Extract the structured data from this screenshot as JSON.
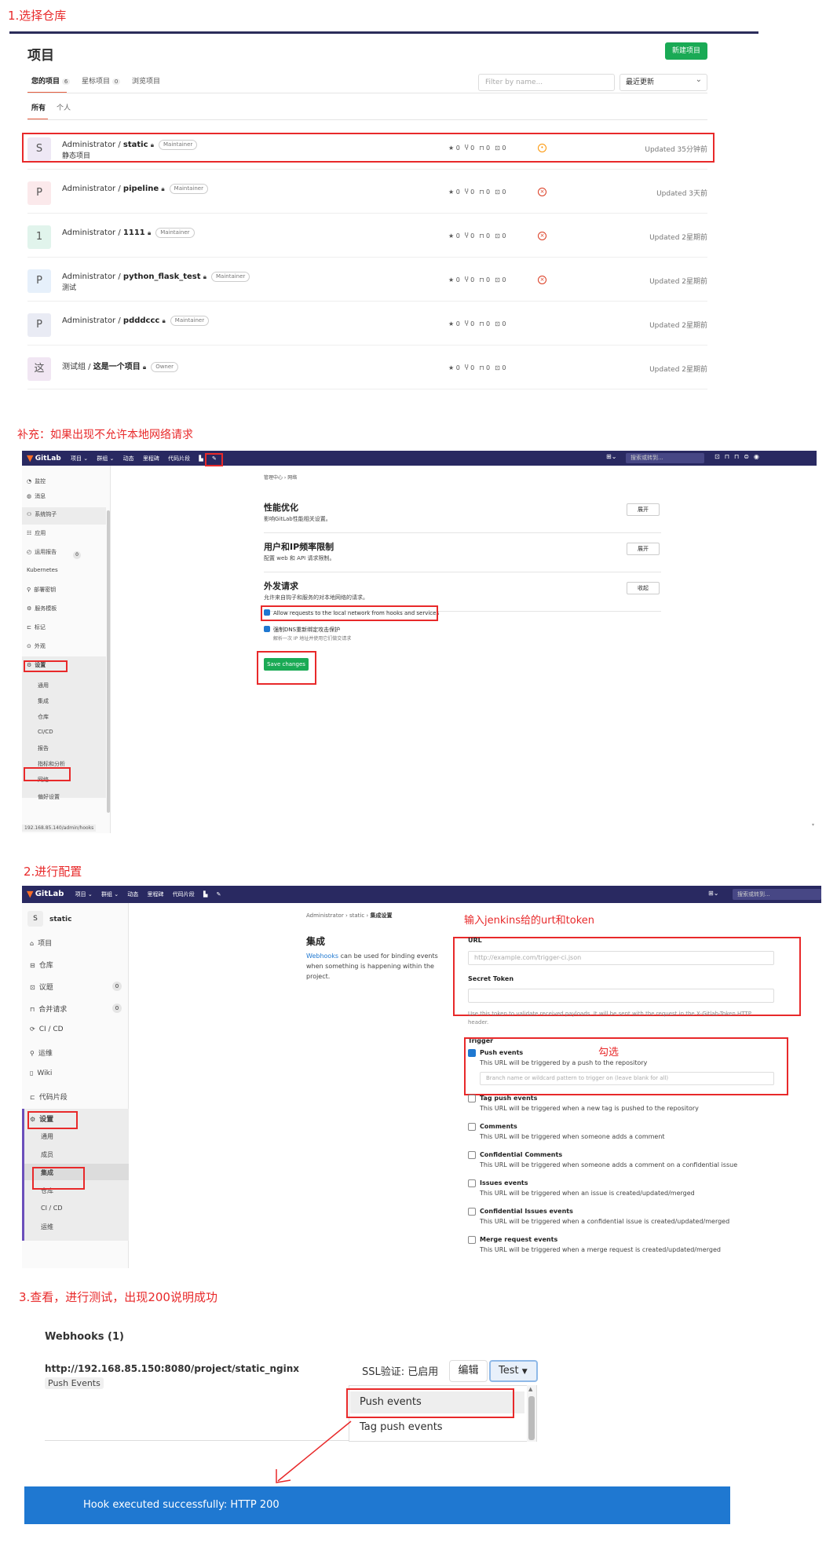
{
  "steps": {
    "s1": "1.选择仓库",
    "supp": "补充：如果出现不允许本地网络请求",
    "s2": "2.进行配置",
    "s3": "3.查看，进行测试，出现200说明成功"
  },
  "projects_page": {
    "title": "项目",
    "new_project": "新建项目",
    "tabs": [
      {
        "label": "您的项目",
        "count": "6"
      },
      {
        "label": "星标项目",
        "count": "0"
      },
      {
        "label": "浏览项目",
        "count": ""
      }
    ],
    "filter_placeholder": "Filter by name...",
    "sort": "最近更新",
    "subtabs": [
      "所有",
      "个人"
    ],
    "projects": [
      {
        "avatar": "S",
        "avatar_color": "#eee8f5",
        "ns": "Administrator / ",
        "name": "static",
        "role": "Maintainer",
        "desc": "静态项目",
        "stars": "0",
        "forks": "0",
        "mrs": "0",
        "issues": "0",
        "status": "running",
        "updated": "Updated 35分钟前"
      },
      {
        "avatar": "P",
        "avatar_color": "#fbe9eb",
        "ns": "Administrator / ",
        "name": "pipeline",
        "role": "Maintainer",
        "desc": "",
        "stars": "0",
        "forks": "0",
        "mrs": "0",
        "issues": "0",
        "status": "failed",
        "updated": "Updated 3天前"
      },
      {
        "avatar": "1",
        "avatar_color": "#e1f4ec",
        "ns": "Administrator / ",
        "name": "1111",
        "role": "Maintainer",
        "desc": "",
        "stars": "0",
        "forks": "0",
        "mrs": "0",
        "issues": "0",
        "status": "failed",
        "updated": "Updated 2星期前"
      },
      {
        "avatar": "P",
        "avatar_color": "#e6f0fb",
        "ns": "Administrator / ",
        "name": "python_flask_test",
        "role": "Maintainer",
        "desc": "测试",
        "stars": "0",
        "forks": "0",
        "mrs": "0",
        "issues": "0",
        "status": "failed",
        "updated": "Updated 2星期前"
      },
      {
        "avatar": "P",
        "avatar_color": "#e9ebf4",
        "ns": "Administrator / ",
        "name": "pdddccc",
        "role": "Maintainer",
        "desc": "",
        "stars": "0",
        "forks": "0",
        "mrs": "0",
        "issues": "0",
        "status": "",
        "updated": "Updated 2星期前"
      },
      {
        "avatar": "这",
        "avatar_color": "#f1e6f3",
        "ns": "测试组 / ",
        "name": "这是一个项目",
        "role": "Owner",
        "desc": "",
        "stars": "0",
        "forks": "0",
        "mrs": "0",
        "issues": "0",
        "status": "",
        "updated": "Updated 2星期前"
      }
    ]
  },
  "admin_page": {
    "brand": "GitLab",
    "nav": [
      "项目 ⌄",
      "群组 ⌄",
      "动态",
      "里程碑",
      "代码片段"
    ],
    "search": "搜索或转到...",
    "sidebar": [
      "监控",
      "消息",
      "系统钩子",
      "应用",
      "运用报告",
      "Kubernetes",
      "部署密钥",
      "服务模板",
      "标记",
      "外观",
      "设置",
      "通用",
      "集成",
      "仓库",
      "CI/CD",
      "报告",
      "指标和分析",
      "网络",
      "偏好设置"
    ],
    "sidebar_badge": "0",
    "breadcrumb": "管理中心 › 网络",
    "sections": [
      {
        "title": "性能优化",
        "desc": "影响GitLab性能相关设置。",
        "btn": "展开"
      },
      {
        "title": "用户和IP频率限制",
        "desc": "配置 web 和 API 请求限制。",
        "btn": "展开"
      },
      {
        "title": "外发请求",
        "desc": "允许来自钩子和服务的对本地网络的请求。",
        "btn": "收起"
      }
    ],
    "allow_local": "Allow requests to the local network from hooks and services",
    "dns_protect": "强制DNS重新绑定攻击保护",
    "dns_desc": "解析一次 IP 地址并使用它们做交请求",
    "save": "Save changes",
    "status_url": "192.168.85.140/admin/hooks"
  },
  "integration_page": {
    "brand": "GitLab",
    "nav": [
      "项目 ⌄",
      "群组 ⌄",
      "动态",
      "里程碑",
      "代码片段"
    ],
    "search": "搜索或转到...",
    "project_avatar": "S",
    "project_name": "static",
    "sidebar": [
      {
        "label": "项目",
        "badge": ""
      },
      {
        "label": "仓库",
        "badge": ""
      },
      {
        "label": "议题",
        "badge": "0"
      },
      {
        "label": "合并请求",
        "badge": "0"
      },
      {
        "label": "CI / CD",
        "badge": ""
      },
      {
        "label": "运维",
        "badge": ""
      },
      {
        "label": "Wiki",
        "badge": ""
      },
      {
        "label": "代码片段",
        "badge": ""
      },
      {
        "label": "设置",
        "badge": ""
      }
    ],
    "settings_sub": [
      "通用",
      "成员",
      "集成",
      "仓库",
      "CI / CD",
      "运维"
    ],
    "breadcrumb": [
      "Administrator",
      "static",
      "集成设置"
    ],
    "title": "集成",
    "intro_link": "Webhooks",
    "intro_text": " can be used for binding events when something is happening within the project.",
    "annot_url": "输入jenkins给的urt和token",
    "annot_check": "勾选",
    "url_label": "URL",
    "url_placeholder": "http://example.com/trigger-ci.json",
    "token_label": "Secret Token",
    "token_help": "Use this token to validate received payloads. It will be sent with the request in the X-Gitlab-Token HTTP header.",
    "trigger_label": "Trigger",
    "branch_placeholder": "Branch name or wildcard pattern to trigger on (leave blank for all)",
    "triggers": [
      {
        "name": "Push events",
        "desc": "This URL will be triggered by a push to the repository",
        "checked": true
      },
      {
        "name": "Tag push events",
        "desc": "This URL will be triggered when a new tag is pushed to the repository",
        "checked": false
      },
      {
        "name": "Comments",
        "desc": "This URL will be triggered when someone adds a comment",
        "checked": false
      },
      {
        "name": "Confidential Comments",
        "desc": "This URL will be triggered when someone adds a comment on a confidential issue",
        "checked": false
      },
      {
        "name": "Issues events",
        "desc": "This URL will be triggered when an issue is created/updated/merged",
        "checked": false
      },
      {
        "name": "Confidential Issues events",
        "desc": "This URL will be triggered when a confidential issue is created/updated/merged",
        "checked": false
      },
      {
        "name": "Merge request events",
        "desc": "This URL will be triggered when a merge request is created/updated/merged",
        "checked": false
      }
    ]
  },
  "webhooks": {
    "title": "Webhooks (1)",
    "url": "http://192.168.85.150:8080/project/static_nginx",
    "events_badge": "Push Events",
    "ssl": "SSL验证: 已启用",
    "edit": "编辑",
    "test": "Test",
    "menu": [
      "Push events",
      "Tag push events"
    ],
    "success": "Hook executed successfully: HTTP 200",
    "success_color": "#1f78d1"
  }
}
